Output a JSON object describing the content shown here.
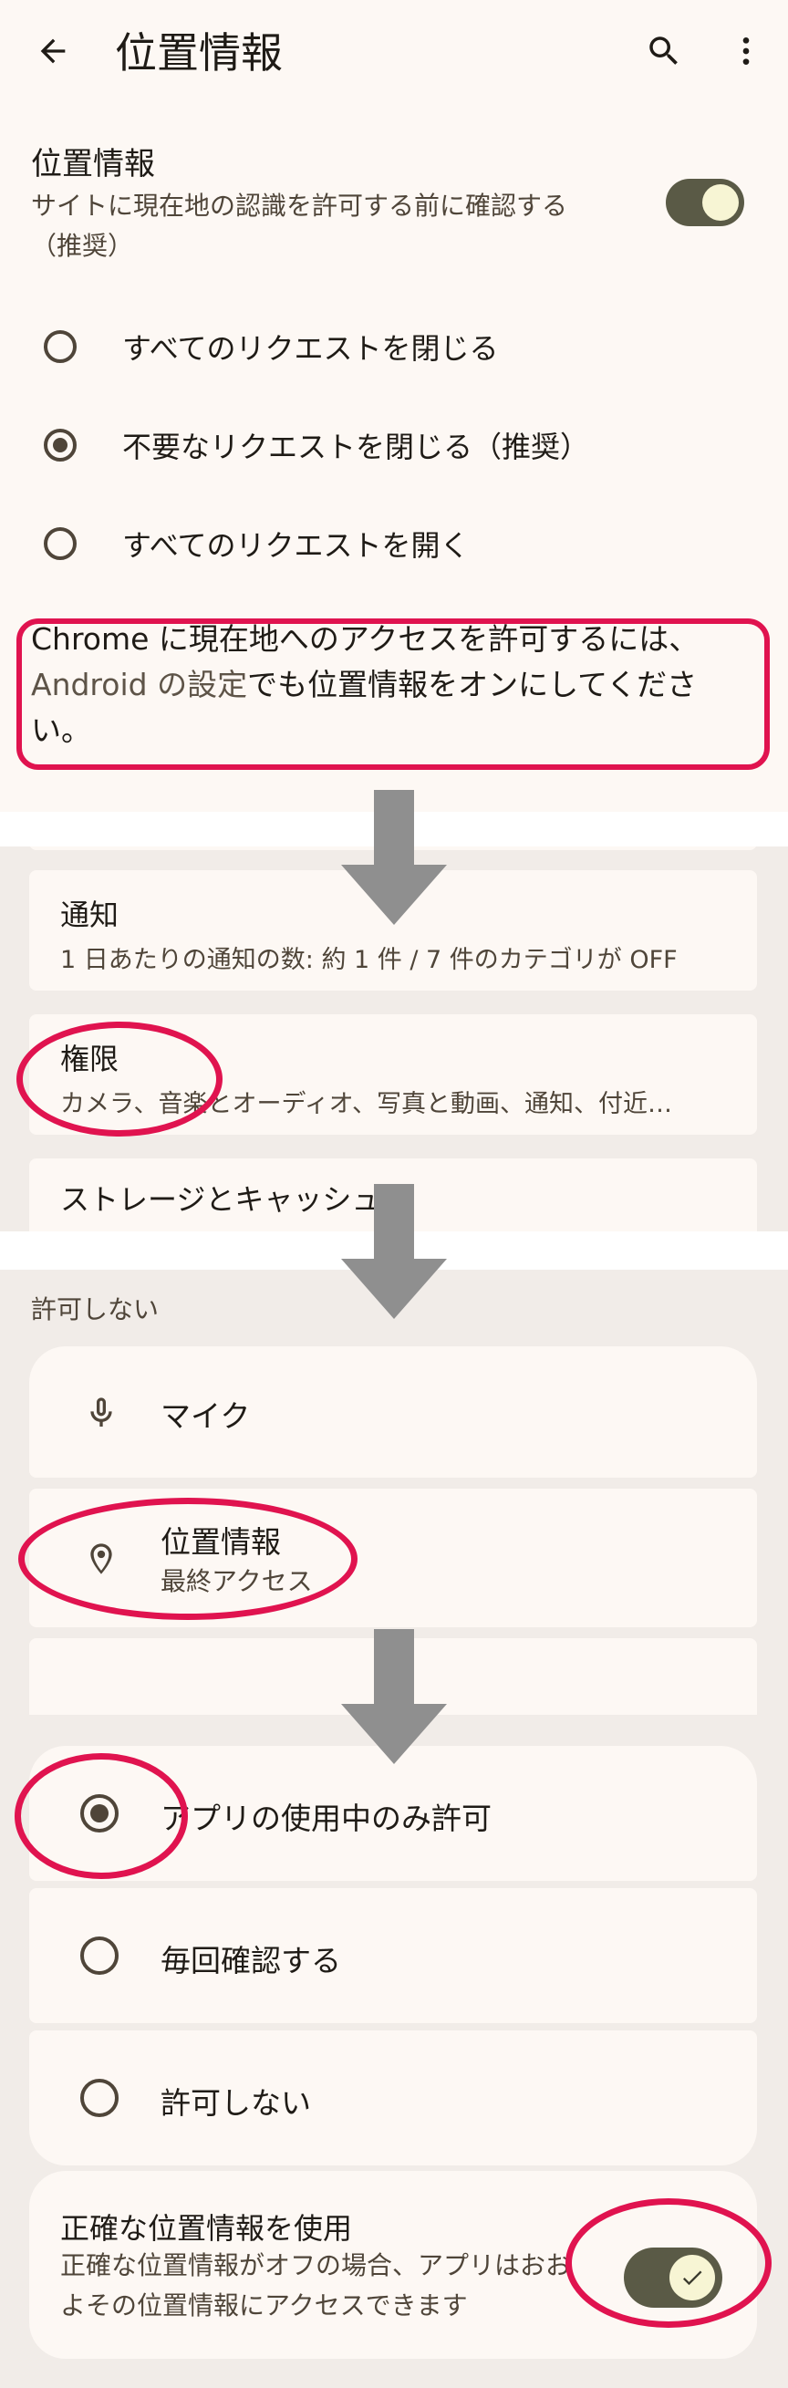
{
  "screen1": {
    "title": "位置情報",
    "setting_title": "位置情報",
    "setting_desc": "サイトに現在地の認識を許可する前に確認する（推奨）",
    "options": [
      "すべてのリクエストを閉じる",
      "不要なリクエストを閉じる（推奨）",
      "すべてのリクエストを開く"
    ],
    "selected_index": 1,
    "notice_prefix": "Chrome に現在地へのアクセスを許可するには、",
    "notice_link": "Android の設定",
    "notice_suffix": "でも位置情報をオンにしてください。",
    "toggle_on": true
  },
  "screen2": {
    "notification_title": "通知",
    "notification_sub": "1 日あたりの通知の数: 約 1 件 / 7 件のカテゴリが OFF",
    "permissions_title": "権限",
    "permissions_sub": "カメラ、音楽とオーディオ、写真と動画、通知、付近…",
    "storage_title": "ストレージとキャッシュ"
  },
  "screen3": {
    "section_label": "許可しない",
    "mic_label": "マイク",
    "location_title": "位置情報",
    "location_sub": "最終アクセス"
  },
  "screen4": {
    "options": [
      "アプリの使用中のみ許可",
      "毎回確認する",
      "許可しない"
    ],
    "selected_index": 0,
    "precise_title": "正確な位置情報を使用",
    "precise_desc": "正確な位置情報がオフの場合、アプリはおおよその位置情報にアクセスできます",
    "precise_on": true
  },
  "colors": {
    "highlight": "#e0134f",
    "arrow": "#8f8f8f",
    "toggle_track": "#5a5a46",
    "toggle_knob": "#f7f5d4"
  },
  "icons": [
    "back-arrow-icon",
    "search-icon",
    "more-vert-icon",
    "mic-icon",
    "location-pin-icon",
    "check-icon",
    "down-arrow-icon"
  ]
}
